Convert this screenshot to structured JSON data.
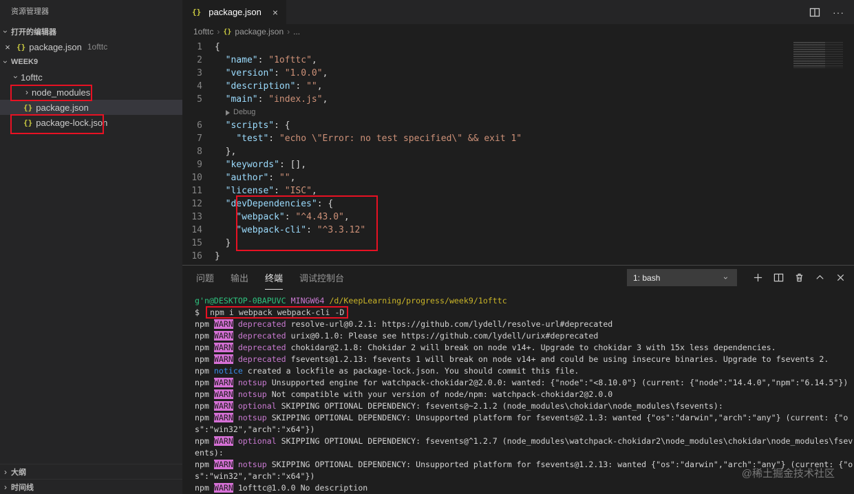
{
  "icons": {
    "json": "{}",
    "close": "×",
    "chevron": "›",
    "ellipsis": "···",
    "plus": "+"
  },
  "colors": {
    "annotation_red": "#e81123",
    "json_key": "#9cdcfe",
    "json_string": "#ce9178",
    "warn_badge": "#d670d6"
  },
  "sidebar": {
    "title": "资源管理器",
    "sections": {
      "open_editors": "打开的编辑器",
      "workspace": "WEEK9",
      "outline": "大纲",
      "timeline": "时间线"
    },
    "open_editor": {
      "file": "package.json",
      "detail": "1ofttc"
    },
    "tree": [
      {
        "label": "1ofttc"
      },
      {
        "label": "node_modules"
      },
      {
        "label": "package.json"
      },
      {
        "label": "package-lock.json"
      }
    ]
  },
  "editor": {
    "tab": "package.json",
    "breadcrumb": [
      "1ofttc",
      "package.json",
      "..."
    ],
    "code_lines": [
      {
        "n": 1,
        "t": [
          [
            "b",
            "{"
          ]
        ]
      },
      {
        "n": 2,
        "t": [
          [
            "w",
            "  "
          ],
          [
            "k",
            "\"name\""
          ],
          [
            "b",
            ": "
          ],
          [
            "s",
            "\"1ofttc\""
          ],
          [
            "b",
            ","
          ]
        ]
      },
      {
        "n": 3,
        "t": [
          [
            "w",
            "  "
          ],
          [
            "k",
            "\"version\""
          ],
          [
            "b",
            ": "
          ],
          [
            "s",
            "\"1.0.0\""
          ],
          [
            "b",
            ","
          ]
        ]
      },
      {
        "n": 4,
        "t": [
          [
            "w",
            "  "
          ],
          [
            "k",
            "\"description\""
          ],
          [
            "b",
            ": "
          ],
          [
            "s",
            "\"\""
          ],
          [
            "b",
            ","
          ]
        ]
      },
      {
        "n": 5,
        "t": [
          [
            "w",
            "  "
          ],
          [
            "k",
            "\"main\""
          ],
          [
            "b",
            ": "
          ],
          [
            "s",
            "\"index.js\""
          ],
          [
            "b",
            ","
          ]
        ]
      },
      {
        "lens": "Debug"
      },
      {
        "n": 6,
        "t": [
          [
            "w",
            "  "
          ],
          [
            "k",
            "\"scripts\""
          ],
          [
            "b",
            ": {"
          ]
        ]
      },
      {
        "n": 7,
        "t": [
          [
            "w",
            "    "
          ],
          [
            "k",
            "\"test\""
          ],
          [
            "b",
            ": "
          ],
          [
            "s",
            "\"echo \\\"Error: no test specified\\\" && exit 1\""
          ]
        ]
      },
      {
        "n": 8,
        "t": [
          [
            "w",
            "  "
          ],
          [
            "b",
            "},"
          ]
        ]
      },
      {
        "n": 9,
        "t": [
          [
            "w",
            "  "
          ],
          [
            "k",
            "\"keywords\""
          ],
          [
            "b",
            ": [],"
          ]
        ]
      },
      {
        "n": 10,
        "t": [
          [
            "w",
            "  "
          ],
          [
            "k",
            "\"author\""
          ],
          [
            "b",
            ": "
          ],
          [
            "s",
            "\"\""
          ],
          [
            "b",
            ","
          ]
        ]
      },
      {
        "n": 11,
        "t": [
          [
            "w",
            "  "
          ],
          [
            "k",
            "\"license\""
          ],
          [
            "b",
            ": "
          ],
          [
            "s",
            "\"ISC\""
          ],
          [
            "b",
            ","
          ]
        ]
      },
      {
        "n": 12,
        "t": [
          [
            "w",
            "  "
          ],
          [
            "k",
            "\"devDependencies\""
          ],
          [
            "b",
            ": {"
          ]
        ]
      },
      {
        "n": 13,
        "t": [
          [
            "w",
            "    "
          ],
          [
            "k",
            "\"webpack\""
          ],
          [
            "b",
            ": "
          ],
          [
            "s",
            "\"^4.43.0\""
          ],
          [
            "b",
            ","
          ]
        ]
      },
      {
        "n": 14,
        "t": [
          [
            "w",
            "    "
          ],
          [
            "k",
            "\"webpack-cli\""
          ],
          [
            "b",
            ": "
          ],
          [
            "s",
            "\"^3.3.12\""
          ]
        ]
      },
      {
        "n": 15,
        "t": [
          [
            "w",
            "  "
          ],
          [
            "b",
            "}"
          ]
        ]
      },
      {
        "n": 16,
        "t": [
          [
            "b",
            "}"
          ]
        ]
      }
    ]
  },
  "panel": {
    "tabs": [
      "问题",
      "输出",
      "终端",
      "调试控制台"
    ],
    "active_tab": "终端",
    "shell": "1: bash",
    "terminal_lines": [
      {
        "t": [
          [
            "g",
            "g'n@DESKTOP-0BAPUVC "
          ],
          [
            "m",
            "MINGW64 "
          ],
          [
            "y",
            "/d/KeepLearning/progress/week9/1ofttc"
          ]
        ]
      },
      {
        "t": [
          [
            "w",
            "$ "
          ],
          [
            "box",
            "npm i webpack webpack-cli -D"
          ]
        ]
      },
      {
        "t": [
          [
            "w",
            "npm "
          ],
          [
            "W",
            "WARN"
          ],
          [
            "w",
            " "
          ],
          [
            "m",
            "deprecated"
          ],
          [
            "w",
            " resolve-url@0.2.1: https://github.com/lydell/resolve-url#deprecated"
          ]
        ]
      },
      {
        "t": [
          [
            "w",
            "npm "
          ],
          [
            "W",
            "WARN"
          ],
          [
            "w",
            " "
          ],
          [
            "m",
            "deprecated"
          ],
          [
            "w",
            " urix@0.1.0: Please see https://github.com/lydell/urix#deprecated"
          ]
        ]
      },
      {
        "t": [
          [
            "w",
            "npm "
          ],
          [
            "W",
            "WARN"
          ],
          [
            "w",
            " "
          ],
          [
            "m",
            "deprecated"
          ],
          [
            "w",
            " chokidar@2.1.8: Chokidar 2 will break on node v14+. Upgrade to chokidar 3 with 15x less dependencies."
          ]
        ]
      },
      {
        "t": [
          [
            "w",
            "npm "
          ],
          [
            "W",
            "WARN"
          ],
          [
            "w",
            " "
          ],
          [
            "m",
            "deprecated"
          ],
          [
            "w",
            " fsevents@1.2.13: fsevents 1 will break on node v14+ and could be using insecure binaries. Upgrade to fsevents 2."
          ]
        ]
      },
      {
        "t": [
          [
            "w",
            "npm "
          ],
          [
            "n",
            "notice"
          ],
          [
            "w",
            " created a lockfile as package-lock.json. You should commit this file."
          ]
        ]
      },
      {
        "t": [
          [
            "w",
            "npm "
          ],
          [
            "W",
            "WARN"
          ],
          [
            "w",
            " "
          ],
          [
            "m",
            "notsup"
          ],
          [
            "w",
            " Unsupported engine for watchpack-chokidar2@2.0.0: wanted: {\"node\":\"<8.10.0\"} (current: {\"node\":\"14.4.0\",\"npm\":\"6.14.5\"})"
          ]
        ]
      },
      {
        "t": [
          [
            "w",
            "npm "
          ],
          [
            "W",
            "WARN"
          ],
          [
            "w",
            " "
          ],
          [
            "m",
            "notsup"
          ],
          [
            "w",
            " Not compatible with your version of node/npm: watchpack-chokidar2@2.0.0"
          ]
        ]
      },
      {
        "t": [
          [
            "w",
            "npm "
          ],
          [
            "W",
            "WARN"
          ],
          [
            "w",
            " "
          ],
          [
            "m",
            "optional"
          ],
          [
            "w",
            " SKIPPING OPTIONAL DEPENDENCY: fsevents@~2.1.2 (node_modules\\chokidar\\node_modules\\fsevents):"
          ]
        ]
      },
      {
        "t": [
          [
            "w",
            "npm "
          ],
          [
            "W",
            "WARN"
          ],
          [
            "w",
            " "
          ],
          [
            "m",
            "notsup"
          ],
          [
            "w",
            " SKIPPING OPTIONAL DEPENDENCY: Unsupported platform for fsevents@2.1.3: wanted {\"os\":\"darwin\",\"arch\":\"any\"} (current: {\"os\":\"win32\",\"arch\":\"x64\"})"
          ]
        ]
      },
      {
        "t": [
          [
            "w",
            "npm "
          ],
          [
            "W",
            "WARN"
          ],
          [
            "w",
            " "
          ],
          [
            "m",
            "optional"
          ],
          [
            "w",
            " SKIPPING OPTIONAL DEPENDENCY: fsevents@^1.2.7 (node_modules\\watchpack-chokidar2\\node_modules\\chokidar\\node_modules\\fsevents):"
          ]
        ]
      },
      {
        "t": [
          [
            "w",
            "npm "
          ],
          [
            "W",
            "WARN"
          ],
          [
            "w",
            " "
          ],
          [
            "m",
            "notsup"
          ],
          [
            "w",
            " SKIPPING OPTIONAL DEPENDENCY: Unsupported platform for fsevents@1.2.13: wanted {\"os\":\"darwin\",\"arch\":\"any\"} (current: {\"os\":\"win32\",\"arch\":\"x64\"})"
          ]
        ]
      },
      {
        "t": [
          [
            "w",
            "npm "
          ],
          [
            "W",
            "WARN"
          ],
          [
            "w",
            " 1ofttc@1.0.0 No description"
          ]
        ]
      }
    ]
  },
  "watermark": "@稀土掘金技术社区"
}
